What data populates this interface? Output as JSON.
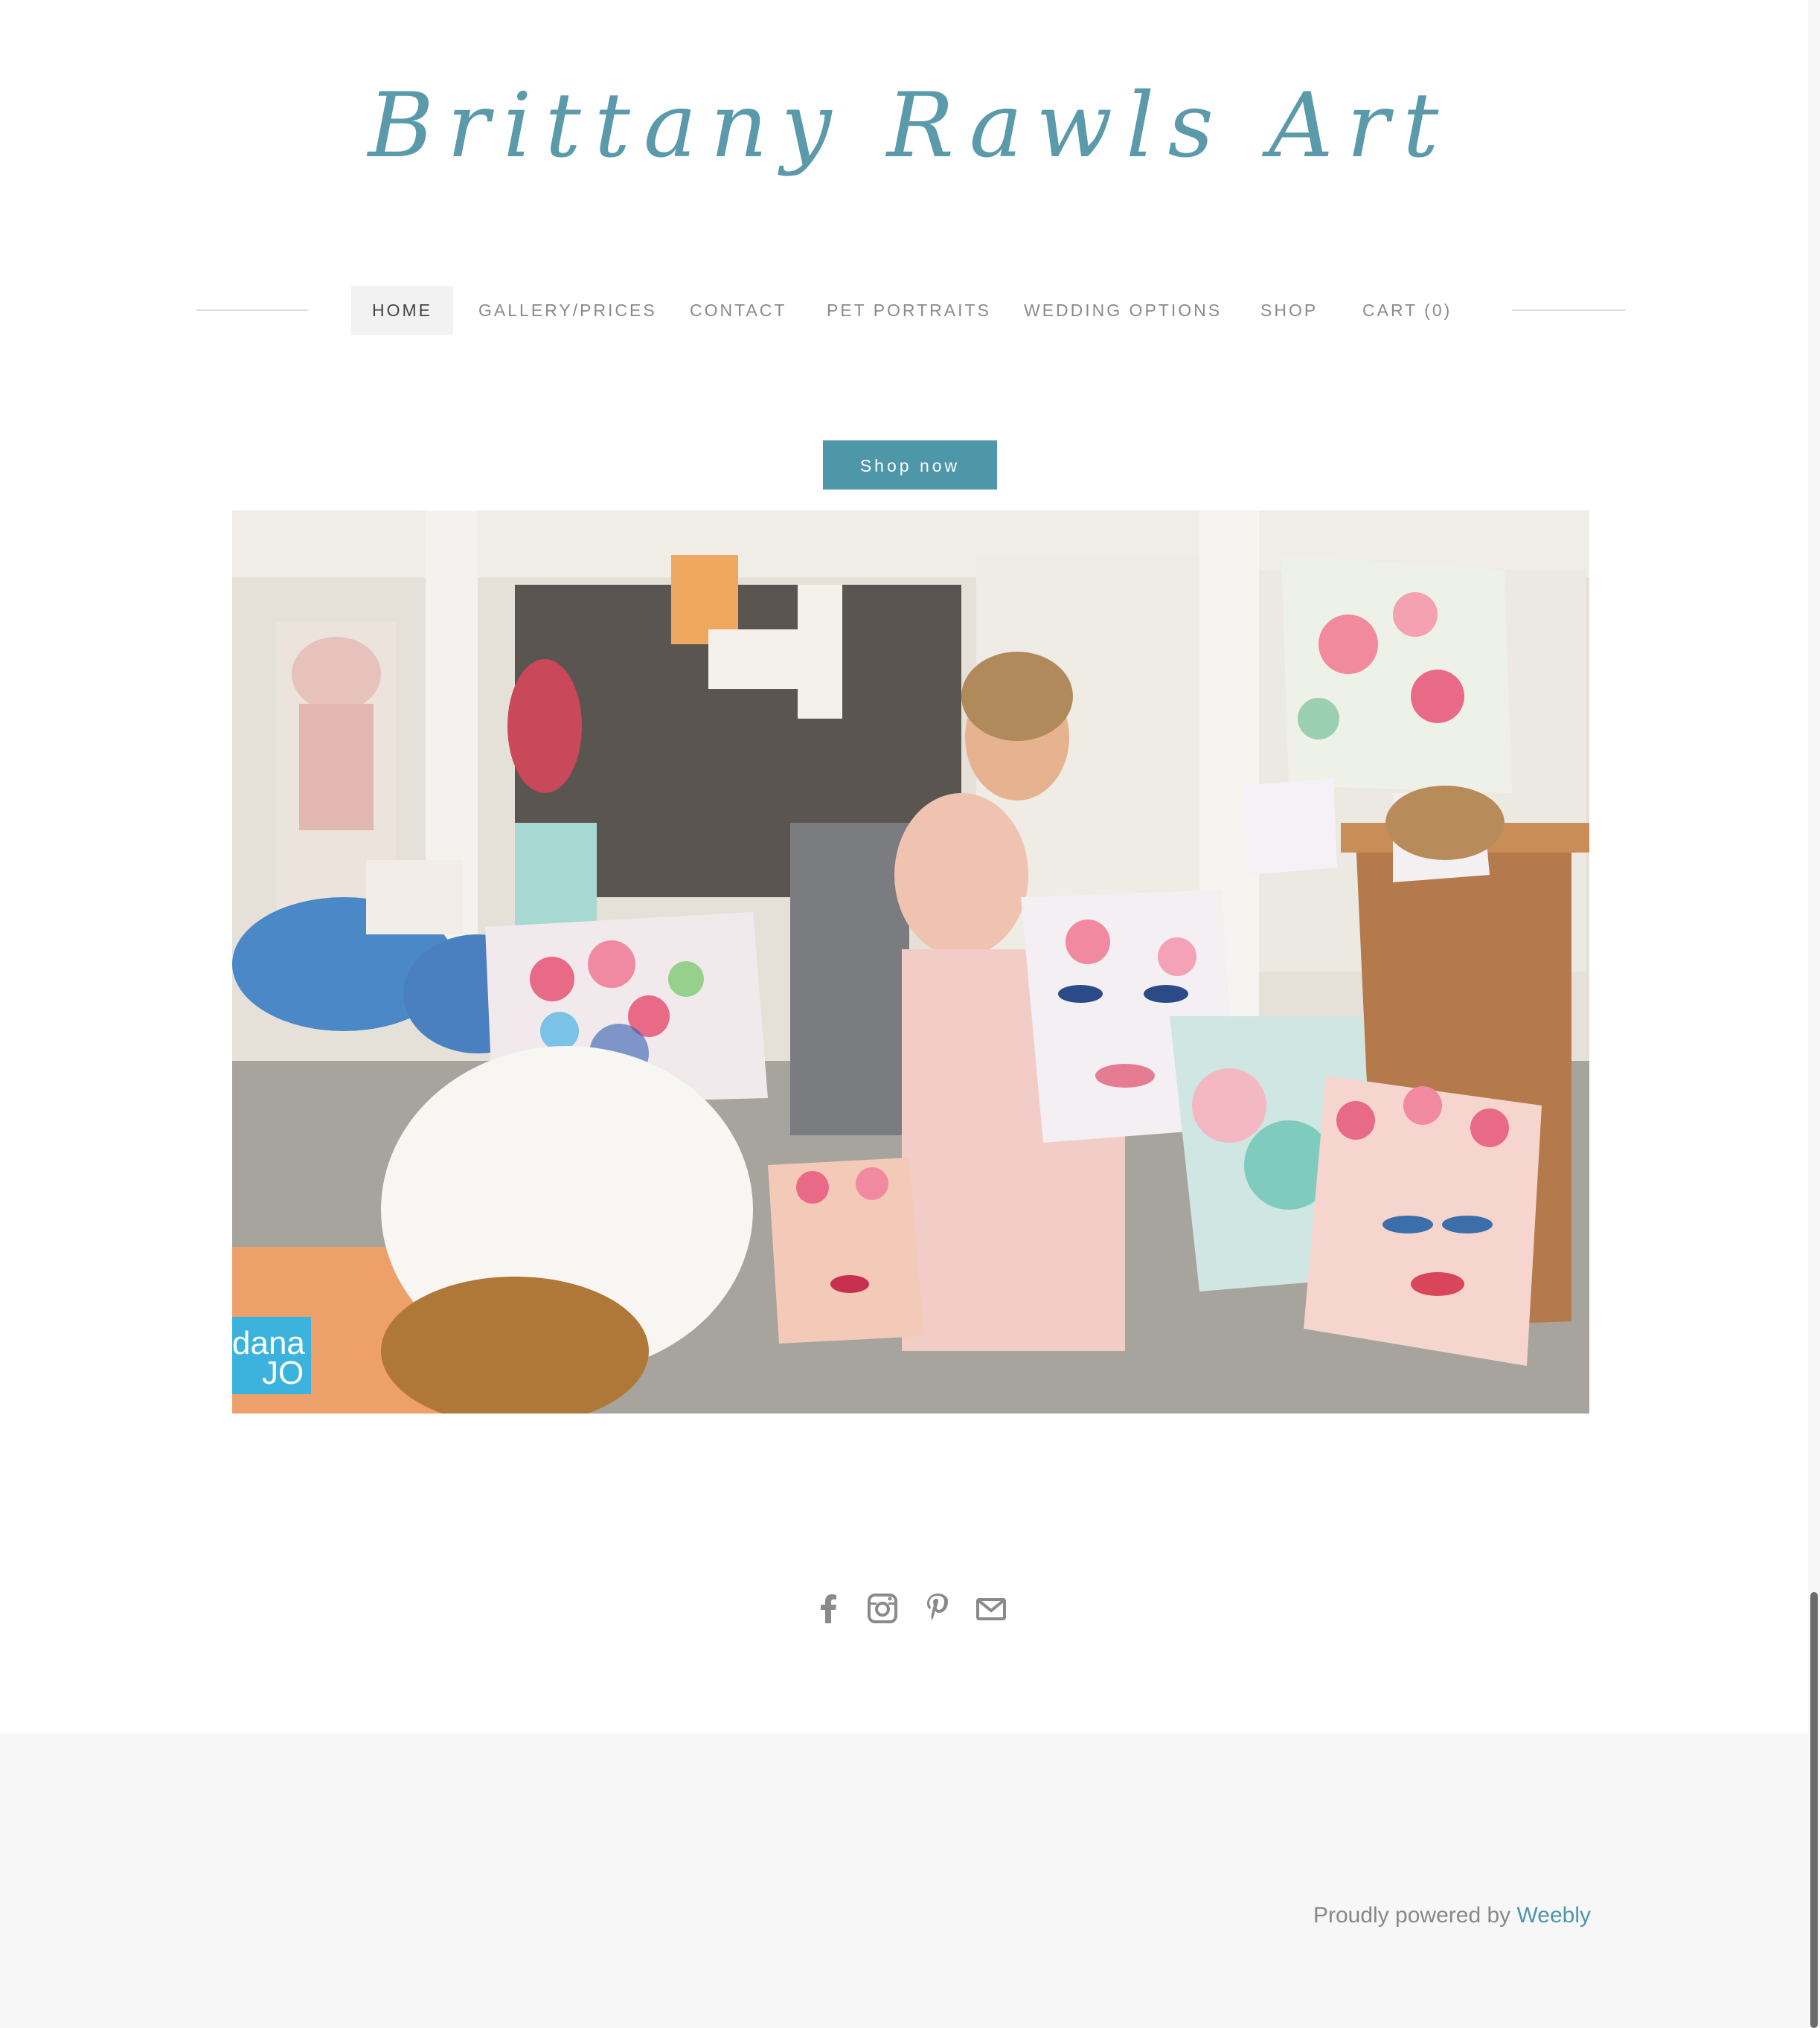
{
  "header": {
    "site_title": "Brittany Rawls Art"
  },
  "nav": {
    "items": [
      {
        "label": "HOME",
        "active": true
      },
      {
        "label": "GALLERY/PRICES",
        "active": false
      },
      {
        "label": "CONTACT",
        "active": false
      },
      {
        "label": "PET PORTRAITS",
        "active": false
      },
      {
        "label": "WEDDING OPTIONS",
        "active": false
      },
      {
        "label": "SHOP",
        "active": false
      },
      {
        "label": "CART (0)",
        "active": false
      }
    ]
  },
  "main": {
    "shop_button": "Shop now",
    "hero_watermark": [
      "dana",
      "JO"
    ]
  },
  "social": {
    "icons": [
      "facebook-icon",
      "instagram-icon",
      "pinterest-icon",
      "mail-icon"
    ]
  },
  "footer": {
    "powered_prefix": "Proudly powered by",
    "powered_link": "Weebly"
  },
  "colors": {
    "accent": "#4e97a8",
    "title": "#5a9aaa",
    "footer_bg": "#f7f7f7"
  }
}
